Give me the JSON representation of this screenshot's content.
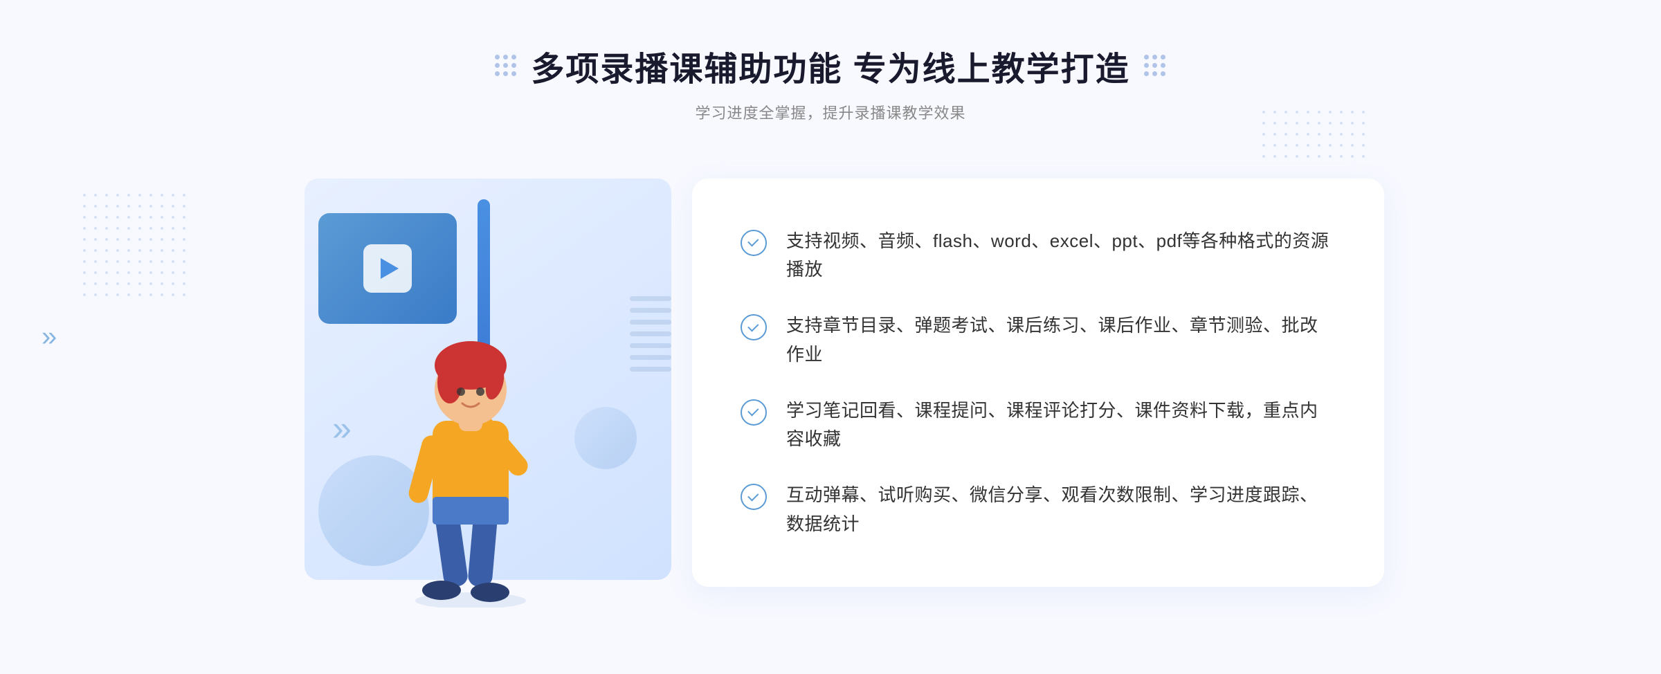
{
  "page": {
    "background_color": "#f0f4ff"
  },
  "header": {
    "title": "多项录播课辅助功能 专为线上教学打造",
    "subtitle": "学习进度全掌握，提升录播课教学效果",
    "title_dots_left": "⁘",
    "title_dots_right": "⁘"
  },
  "features": [
    {
      "id": 1,
      "text": "支持视频、音频、flash、word、excel、ppt、pdf等各种格式的资源播放"
    },
    {
      "id": 2,
      "text": "支持章节目录、弹题考试、课后练习、课后作业、章节测验、批改作业"
    },
    {
      "id": 3,
      "text": "学习笔记回看、课程提问、课程评论打分、课件资料下载，重点内容收藏"
    },
    {
      "id": 4,
      "text": "互动弹幕、试听购买、微信分享、观看次数限制、学习进度跟踪、数据统计"
    }
  ],
  "decoration": {
    "arrow_left": "»",
    "play_button_label": "播放"
  }
}
